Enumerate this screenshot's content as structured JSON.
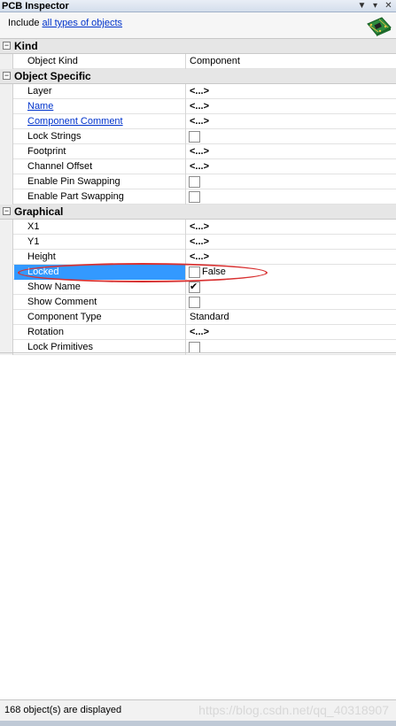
{
  "panel": {
    "title": "PCB Inspector"
  },
  "include": {
    "prefix": "Include",
    "link": "all types of objects"
  },
  "categories": {
    "kind": {
      "label": "Kind",
      "rows": [
        {
          "name": "Object Kind",
          "value": "Component"
        }
      ]
    },
    "object_specific": {
      "label": "Object Specific",
      "rows": [
        {
          "name": "Layer",
          "value": "<...>"
        },
        {
          "name": "Name",
          "value": "<...>"
        },
        {
          "name": "Component Comment",
          "value": "<...>"
        },
        {
          "name": "Lock Strings",
          "checked": false
        },
        {
          "name": "Footprint",
          "value": "<...>"
        },
        {
          "name": "Channel Offset",
          "value": "<...>"
        },
        {
          "name": "Enable Pin Swapping",
          "checked": false
        },
        {
          "name": "Enable Part Swapping",
          "checked": false
        }
      ]
    },
    "graphical": {
      "label": "Graphical",
      "rows": [
        {
          "name": "X1",
          "value": "<...>"
        },
        {
          "name": "Y1",
          "value": "<...>"
        },
        {
          "name": "Height",
          "value": "<...>"
        },
        {
          "name": "Locked",
          "checked": false,
          "value_text": "False",
          "selected": true
        },
        {
          "name": "Show Name",
          "checked": true
        },
        {
          "name": "Show Comment",
          "checked": false
        },
        {
          "name": "Component Type",
          "value": "Standard"
        },
        {
          "name": "Rotation",
          "value": "<...>"
        },
        {
          "name": "Lock Primitives",
          "checked": false
        }
      ]
    }
  },
  "status": {
    "text": "168 object(s) are displayed",
    "watermark": "https://blog.csdn.net/qq_40318907"
  },
  "colors": {
    "selection": "#3399ff",
    "link": "#0033cc",
    "annotation": "#d83030"
  },
  "icons": {
    "menu": "dropdown-arrow-icon",
    "pin": "pin-icon",
    "close": "close-icon",
    "pcb": "pcb-board-icon"
  }
}
